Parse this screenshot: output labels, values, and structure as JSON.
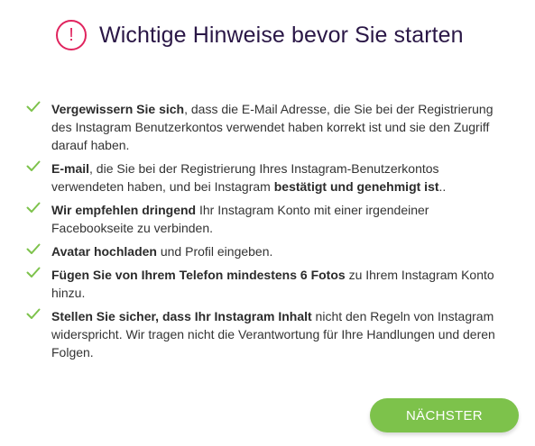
{
  "header": {
    "icon": "exclamation-circle-icon",
    "icon_glyph": "!",
    "title": "Wichtige Hinweise bevor Sie starten",
    "accent_color": "#e0245e",
    "title_color": "#2a1746"
  },
  "checklist": {
    "check_icon": "checkmark-icon",
    "check_color": "#7dc24b",
    "items": [
      {
        "parts": [
          {
            "bold": true,
            "text": "Vergewissern Sie sich"
          },
          {
            "bold": false,
            "text": ", dass die E-Mail Adresse, die Sie bei der Registrierung des Instagram Benutzerkontos verwendet haben korrekt ist und sie den Zugriff darauf haben."
          }
        ]
      },
      {
        "parts": [
          {
            "bold": true,
            "text": "E-mail"
          },
          {
            "bold": false,
            "text": ", die Sie bei der Registrierung Ihres Instagram-Benutzerkontos verwendeten haben, und bei Instagram "
          },
          {
            "bold": true,
            "text": "bestätigt und genehmigt ist"
          },
          {
            "bold": false,
            "text": ".."
          }
        ]
      },
      {
        "parts": [
          {
            "bold": true,
            "text": "Wir empfehlen dringend"
          },
          {
            "bold": false,
            "text": " Ihr Instagram Konto mit einer irgendeiner Facebookseite zu verbinden."
          }
        ]
      },
      {
        "parts": [
          {
            "bold": true,
            "text": "Avatar hochladen"
          },
          {
            "bold": false,
            "text": " und Profil eingeben."
          }
        ]
      },
      {
        "parts": [
          {
            "bold": true,
            "text": "Fügen Sie von Ihrem Telefon mindestens 6 Fotos"
          },
          {
            "bold": false,
            "text": " zu Ihrem Instagram Konto hinzu."
          }
        ]
      },
      {
        "parts": [
          {
            "bold": true,
            "text": "Stellen Sie sicher, dass Ihr Instagram Inhalt"
          },
          {
            "bold": false,
            "text": " nicht den Regeln von Instagram widerspricht. Wir tragen nicht die Verantwortung für Ihre Handlungen und deren Folgen."
          }
        ]
      }
    ]
  },
  "footer": {
    "next_label": "NÄCHSTER",
    "button_color": "#7dc24b"
  }
}
